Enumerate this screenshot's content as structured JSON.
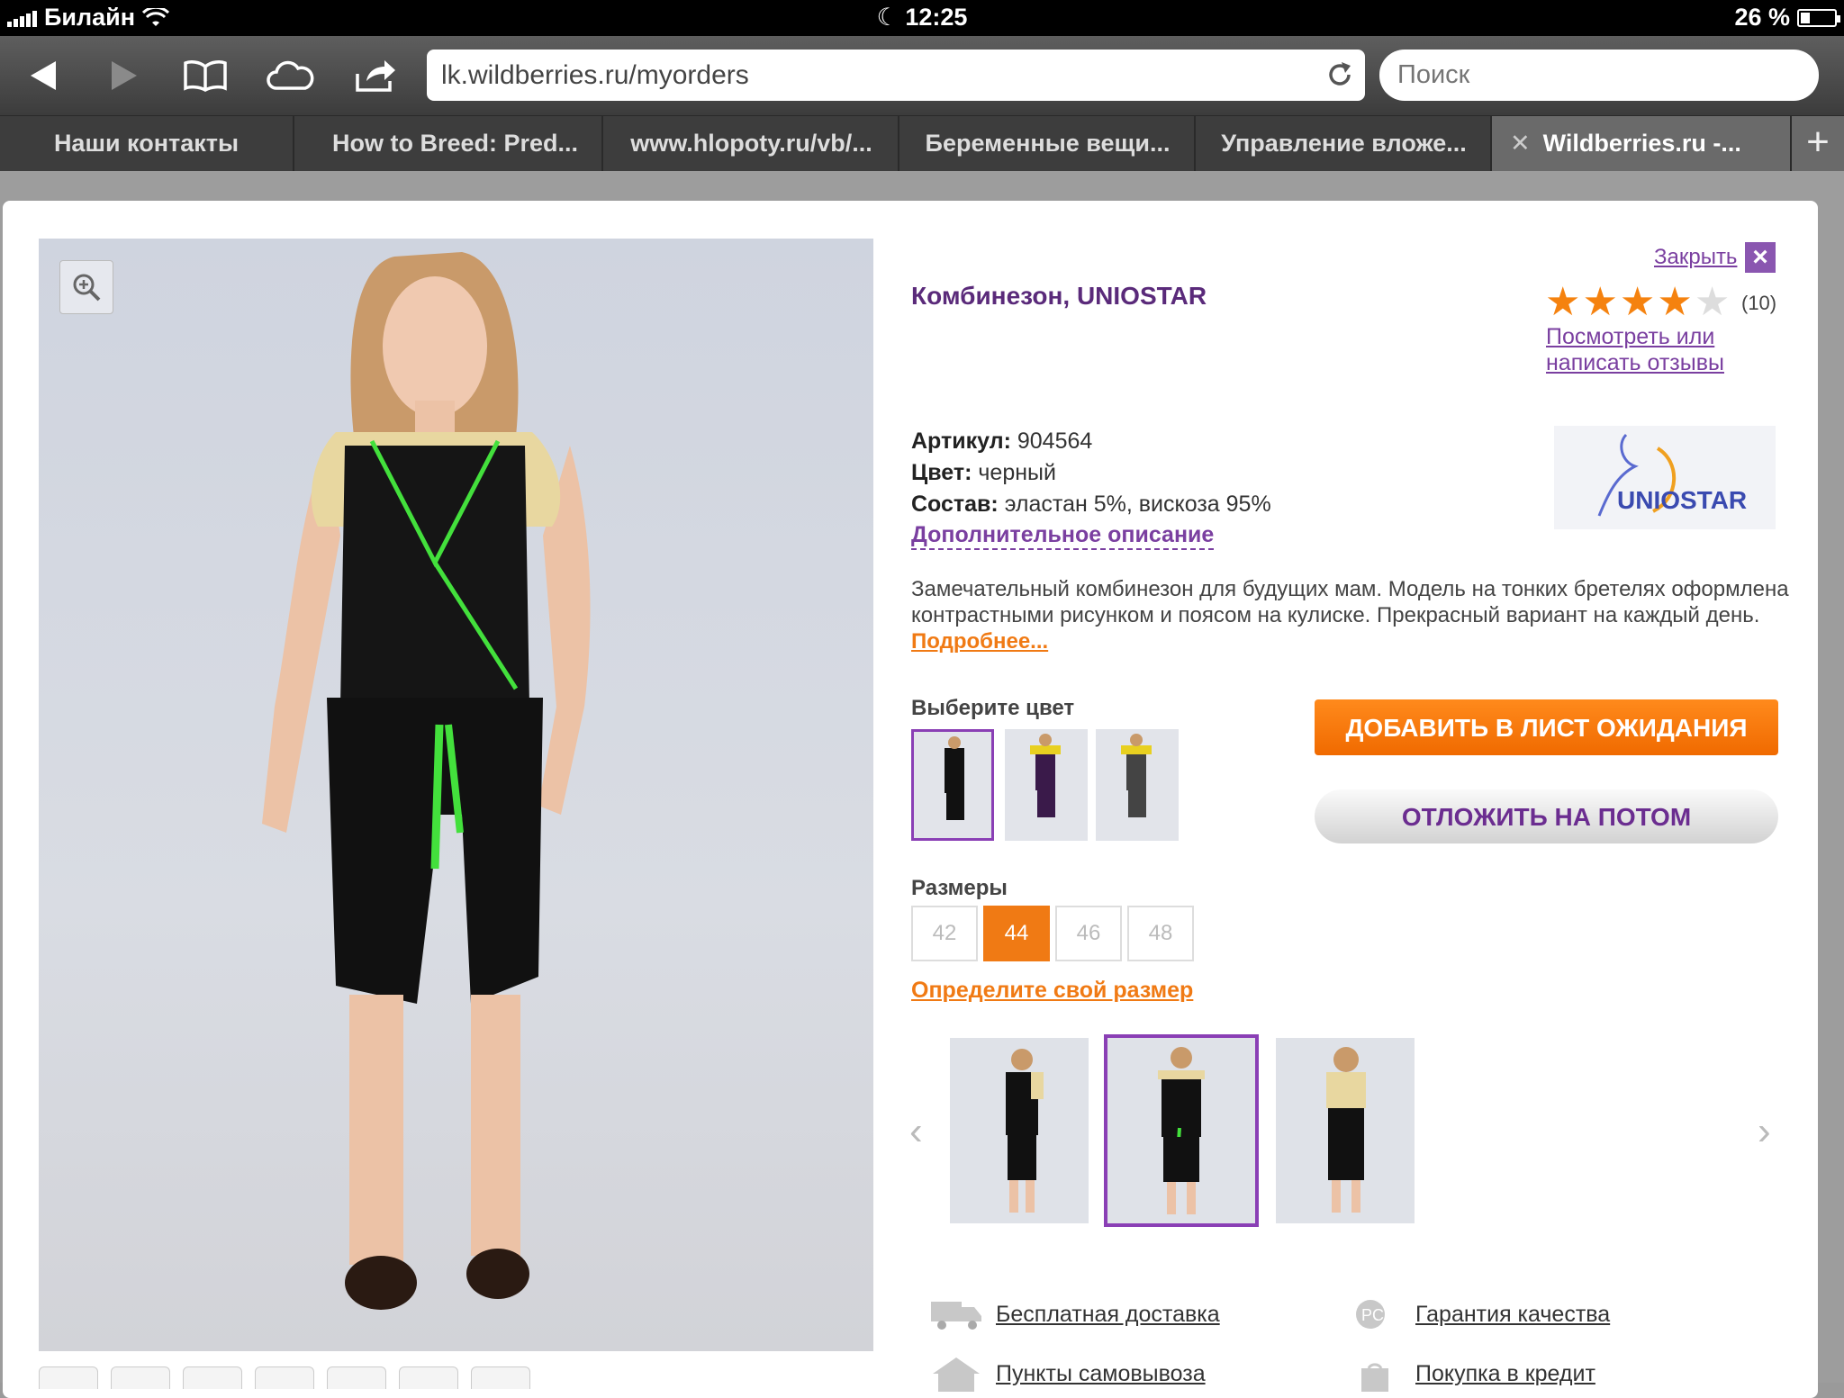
{
  "status_bar": {
    "carrier": "Билайн",
    "time": "12:25",
    "battery": "26 %",
    "battery_level": 0.26
  },
  "browser": {
    "url": "lk.wildberries.ru/myorders",
    "search_placeholder": "Поиск",
    "tabs": [
      {
        "label": "Наши контакты"
      },
      {
        "label": "How to Breed: Pred..."
      },
      {
        "label": "www.hlopoty.ru/vb/..."
      },
      {
        "label": "Беременные вещи..."
      },
      {
        "label": "Управление вложе..."
      },
      {
        "label": "Wildberries.ru -..."
      }
    ],
    "close_tab_glyph": "✕",
    "new_tab_glyph": "+"
  },
  "product": {
    "title": "Комбинезон, UNIOSTAR",
    "close_label": "Закрыть",
    "rating": 4,
    "rating_max": 5,
    "reviews_count": "(10)",
    "reviews_link": "Посмотреть или написать отзывы",
    "brand_logo_text": "UNIOSTAR",
    "article_label": "Артикул:",
    "article_value": "904564",
    "color_label": "Цвет:",
    "color_value": "черный",
    "composition_label": "Состав:",
    "composition_value": "эластан 5%, вискоза 95%",
    "extra_description": "Дополнительное описание",
    "description": "Замечательный комбинезон для будущих мам. Модель на тонких бретелях оформлена контрастными рисунком и поясом на кулиске. Прекрасный вариант на каждый день.",
    "more_link": "Подробнее...",
    "choose_color_label": "Выберите цвет",
    "color_options": [
      "black",
      "purple",
      "grey"
    ],
    "add_waitlist_button": "ДОБАВИТЬ В ЛИСТ ОЖИДАНИЯ",
    "postpone_button": "ОТЛОЖИТЬ НА ПОТОМ",
    "sizes_label": "Размеры",
    "sizes": [
      "42",
      "44",
      "46",
      "48"
    ],
    "selected_size": "44",
    "size_link": "Определите свой размер",
    "features": [
      {
        "label": "Бесплатная доставка",
        "icon": "truck-icon"
      },
      {
        "label": "Гарантия качества",
        "icon": "quality-badge-icon"
      },
      {
        "label": "Пункты самовывоза",
        "icon": "pickup-house-icon"
      },
      {
        "label": "Покупка в кредит",
        "icon": "credit-bag-icon"
      }
    ]
  },
  "colors": {
    "accent_purple": "#7a3fa0",
    "accent_orange": "#f07a14",
    "title_purple": "#5a2a7a",
    "star_orange": "#f5820f"
  }
}
